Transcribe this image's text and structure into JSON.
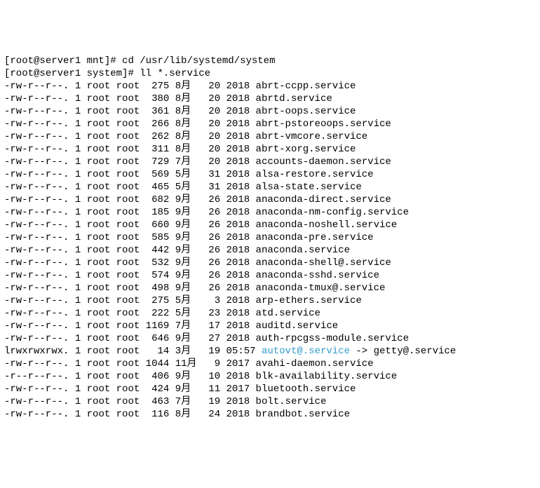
{
  "prompt1": {
    "prefix": "[",
    "host": "root@server1 mnt",
    "suffix": "]# ",
    "command": "cd /usr/lib/systemd/system"
  },
  "prompt2": {
    "prefix": "[",
    "host": "root@server1 system",
    "suffix": "]# ",
    "command": "ll *.service"
  },
  "files": [
    {
      "perm": "-rw-r--r--.",
      "links": "1",
      "owner": "root",
      "group": "root",
      "size": " 275",
      "month": "8月 ",
      "day": " 20",
      "time": "2018",
      "name": "abrt-ccpp.service"
    },
    {
      "perm": "-rw-r--r--.",
      "links": "1",
      "owner": "root",
      "group": "root",
      "size": " 380",
      "month": "8月 ",
      "day": " 20",
      "time": "2018",
      "name": "abrtd.service"
    },
    {
      "perm": "-rw-r--r--.",
      "links": "1",
      "owner": "root",
      "group": "root",
      "size": " 361",
      "month": "8月 ",
      "day": " 20",
      "time": "2018",
      "name": "abrt-oops.service"
    },
    {
      "perm": "-rw-r--r--.",
      "links": "1",
      "owner": "root",
      "group": "root",
      "size": " 266",
      "month": "8月 ",
      "day": " 20",
      "time": "2018",
      "name": "abrt-pstoreoops.service"
    },
    {
      "perm": "-rw-r--r--.",
      "links": "1",
      "owner": "root",
      "group": "root",
      "size": " 262",
      "month": "8月 ",
      "day": " 20",
      "time": "2018",
      "name": "abrt-vmcore.service"
    },
    {
      "perm": "-rw-r--r--.",
      "links": "1",
      "owner": "root",
      "group": "root",
      "size": " 311",
      "month": "8月 ",
      "day": " 20",
      "time": "2018",
      "name": "abrt-xorg.service"
    },
    {
      "perm": "-rw-r--r--.",
      "links": "1",
      "owner": "root",
      "group": "root",
      "size": " 729",
      "month": "7月 ",
      "day": " 20",
      "time": "2018",
      "name": "accounts-daemon.service"
    },
    {
      "perm": "-rw-r--r--.",
      "links": "1",
      "owner": "root",
      "group": "root",
      "size": " 569",
      "month": "5月 ",
      "day": " 31",
      "time": "2018",
      "name": "alsa-restore.service"
    },
    {
      "perm": "-rw-r--r--.",
      "links": "1",
      "owner": "root",
      "group": "root",
      "size": " 465",
      "month": "5月 ",
      "day": " 31",
      "time": "2018",
      "name": "alsa-state.service"
    },
    {
      "perm": "-rw-r--r--.",
      "links": "1",
      "owner": "root",
      "group": "root",
      "size": " 682",
      "month": "9月 ",
      "day": " 26",
      "time": "2018",
      "name": "anaconda-direct.service"
    },
    {
      "perm": "-rw-r--r--.",
      "links": "1",
      "owner": "root",
      "group": "root",
      "size": " 185",
      "month": "9月 ",
      "day": " 26",
      "time": "2018",
      "name": "anaconda-nm-config.service"
    },
    {
      "perm": "-rw-r--r--.",
      "links": "1",
      "owner": "root",
      "group": "root",
      "size": " 660",
      "month": "9月 ",
      "day": " 26",
      "time": "2018",
      "name": "anaconda-noshell.service"
    },
    {
      "perm": "-rw-r--r--.",
      "links": "1",
      "owner": "root",
      "group": "root",
      "size": " 585",
      "month": "9月 ",
      "day": " 26",
      "time": "2018",
      "name": "anaconda-pre.service"
    },
    {
      "perm": "-rw-r--r--.",
      "links": "1",
      "owner": "root",
      "group": "root",
      "size": " 442",
      "month": "9月 ",
      "day": " 26",
      "time": "2018",
      "name": "anaconda.service"
    },
    {
      "perm": "-rw-r--r--.",
      "links": "1",
      "owner": "root",
      "group": "root",
      "size": " 532",
      "month": "9月 ",
      "day": " 26",
      "time": "2018",
      "name": "anaconda-shell@.service"
    },
    {
      "perm": "-rw-r--r--.",
      "links": "1",
      "owner": "root",
      "group": "root",
      "size": " 574",
      "month": "9月 ",
      "day": " 26",
      "time": "2018",
      "name": "anaconda-sshd.service"
    },
    {
      "perm": "-rw-r--r--.",
      "links": "1",
      "owner": "root",
      "group": "root",
      "size": " 498",
      "month": "9月 ",
      "day": " 26",
      "time": "2018",
      "name": "anaconda-tmux@.service"
    },
    {
      "perm": "-rw-r--r--.",
      "links": "1",
      "owner": "root",
      "group": "root",
      "size": " 275",
      "month": "5月 ",
      "day": "  3",
      "time": "2018",
      "name": "arp-ethers.service"
    },
    {
      "perm": "-rw-r--r--.",
      "links": "1",
      "owner": "root",
      "group": "root",
      "size": " 222",
      "month": "5月 ",
      "day": " 23",
      "time": "2018",
      "name": "atd.service"
    },
    {
      "perm": "-rw-r--r--.",
      "links": "1",
      "owner": "root",
      "group": "root",
      "size": "1169",
      "month": "7月 ",
      "day": " 17",
      "time": "2018",
      "name": "auditd.service"
    },
    {
      "perm": "-rw-r--r--.",
      "links": "1",
      "owner": "root",
      "group": "root",
      "size": " 646",
      "month": "9月 ",
      "day": " 27",
      "time": "2018",
      "name": "auth-rpcgss-module.service"
    },
    {
      "perm": "lrwxrwxrwx.",
      "links": "1",
      "owner": "root",
      "group": "root",
      "size": "  14",
      "month": "3月 ",
      "day": " 19",
      "time": "05:57",
      "name": "autovt@.service",
      "symlink": true,
      "target": " -> getty@.service"
    },
    {
      "perm": "-rw-r--r--.",
      "links": "1",
      "owner": "root",
      "group": "root",
      "size": "1044",
      "month": "11月",
      "day": "  9",
      "time": "2017",
      "name": "avahi-daemon.service"
    },
    {
      "perm": "-r--r--r--.",
      "links": "1",
      "owner": "root",
      "group": "root",
      "size": " 406",
      "month": "9月 ",
      "day": " 10",
      "time": "2018",
      "name": "blk-availability.service"
    },
    {
      "perm": "-rw-r--r--.",
      "links": "1",
      "owner": "root",
      "group": "root",
      "size": " 424",
      "month": "9月 ",
      "day": " 11",
      "time": "2017",
      "name": "bluetooth.service"
    },
    {
      "perm": "-rw-r--r--.",
      "links": "1",
      "owner": "root",
      "group": "root",
      "size": " 463",
      "month": "7月 ",
      "day": " 19",
      "time": "2018",
      "name": "bolt.service"
    },
    {
      "perm": "-rw-r--r--.",
      "links": "1",
      "owner": "root",
      "group": "root",
      "size": " 116",
      "month": "8月 ",
      "day": " 24",
      "time": "2018",
      "name": "brandbot.service"
    }
  ]
}
